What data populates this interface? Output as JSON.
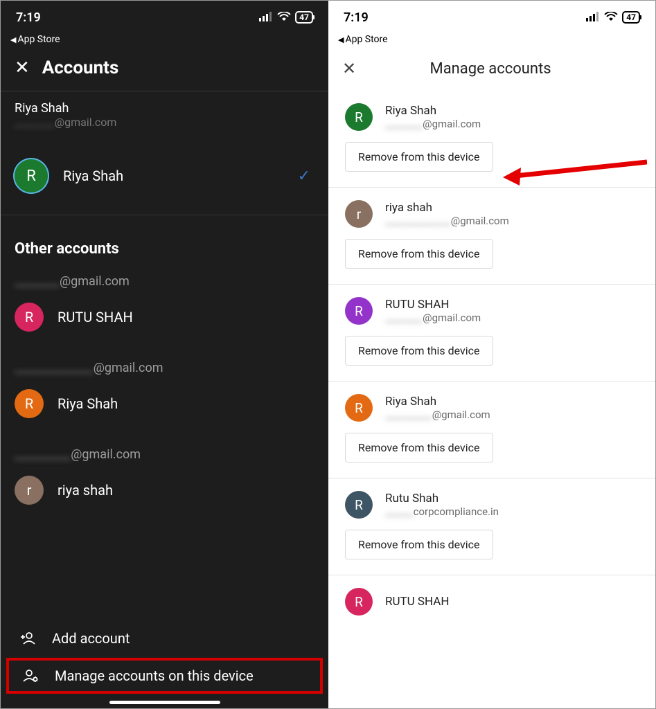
{
  "status": {
    "time": "7:19",
    "back": "App Store",
    "battery": "47"
  },
  "left": {
    "title": "Accounts",
    "current": {
      "name": "Riya Shah",
      "emailPrefix": "________",
      "emailSuffix": "@gmail.com"
    },
    "selected": {
      "name": "Riya Shah",
      "initial": "R",
      "color": "c-green"
    },
    "otherTitle": "Other accounts",
    "others": [
      {
        "emailPrefix": "________",
        "emailSuffix": "@gmail.com",
        "initial": "R",
        "name": "RUTU SHAH",
        "color": "c-pink"
      },
      {
        "emailPrefix": "______________",
        "emailSuffix": "@gmail.com",
        "initial": "R",
        "name": "Riya Shah",
        "color": "c-orange"
      },
      {
        "emailPrefix": "__________",
        "emailSuffix": "@gmail.com",
        "initial": "r",
        "name": "riya shah",
        "color": "c-brown"
      }
    ],
    "add": "Add account",
    "manage": "Manage accounts on this device"
  },
  "right": {
    "title": "Manage accounts",
    "removeLabel": "Remove from this device",
    "accounts": [
      {
        "name": "Riya Shah",
        "emailPrefix": "________",
        "emailSuffix": "@gmail.com",
        "initial": "R",
        "color": "c-green"
      },
      {
        "name": "riya shah",
        "emailPrefix": "______________",
        "emailSuffix": "@gmail.com",
        "initial": "r",
        "color": "c-brown"
      },
      {
        "name": "RUTU SHAH",
        "emailPrefix": "________",
        "emailSuffix": "@gmail.com",
        "initial": "R",
        "color": "c-purple"
      },
      {
        "name": "Riya Shah",
        "emailPrefix": "__________",
        "emailSuffix": "@gmail.com",
        "initial": "R",
        "color": "c-orange"
      },
      {
        "name": "Rutu Shah",
        "emailPrefix": "______",
        "emailSuffix": "corpcompliance.in",
        "initial": "R",
        "color": "c-slate"
      }
    ],
    "partial": {
      "name": "RUTU SHAH",
      "initial": "R",
      "color": "c-pink"
    }
  }
}
